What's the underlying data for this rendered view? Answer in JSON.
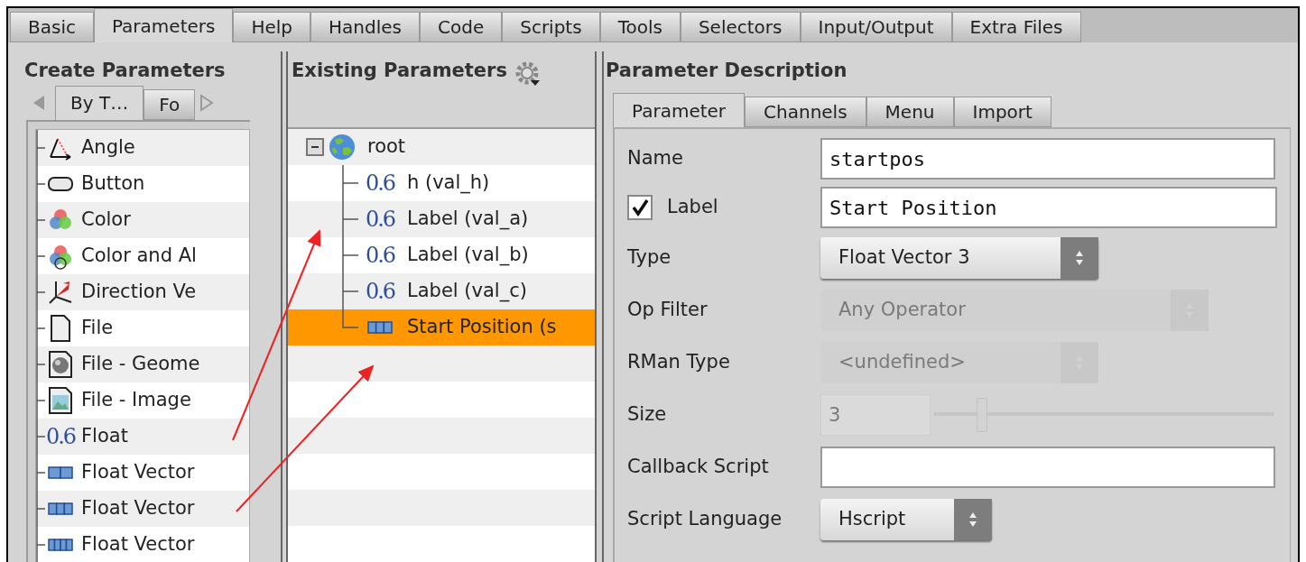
{
  "tabs": [
    {
      "label": "Basic",
      "selected": false
    },
    {
      "label": "Parameters",
      "selected": true
    },
    {
      "label": "Help",
      "selected": false
    },
    {
      "label": "Handles",
      "selected": false
    },
    {
      "label": "Code",
      "selected": false
    },
    {
      "label": "Scripts",
      "selected": false
    },
    {
      "label": "Tools",
      "selected": false
    },
    {
      "label": "Selectors",
      "selected": false
    },
    {
      "label": "Input/Output",
      "selected": false
    },
    {
      "label": "Extra Files",
      "selected": false
    }
  ],
  "create_parameters": {
    "title": "Create Parameters",
    "tabs": [
      {
        "label": "By T…",
        "selected": true
      },
      {
        "label": "Fo",
        "selected": false
      }
    ],
    "items": [
      {
        "label": "Angle",
        "kind": "angle"
      },
      {
        "label": "Button",
        "kind": "button"
      },
      {
        "label": "Color",
        "kind": "color"
      },
      {
        "label": "Color and Al",
        "kind": "color_alpha"
      },
      {
        "label": "Direction Ve",
        "kind": "direction"
      },
      {
        "label": "File",
        "kind": "file"
      },
      {
        "label": "File - Geome",
        "kind": "file_geometry"
      },
      {
        "label": "File - Image",
        "kind": "file_image"
      },
      {
        "label": "Float",
        "kind": "float",
        "icon_text": "0.6"
      },
      {
        "label": "Float Vector",
        "kind": "vector2"
      },
      {
        "label": "Float Vector",
        "kind": "vector3"
      },
      {
        "label": "Float Vector",
        "kind": "vector4"
      }
    ]
  },
  "existing_parameters": {
    "title": "Existing Parameters",
    "tree": {
      "label": "root",
      "expanded": true,
      "children": [
        {
          "label": "h (val_h)",
          "kind": "float",
          "icon_text": "0.6",
          "selected": false
        },
        {
          "label": "Label (val_a)",
          "kind": "float",
          "icon_text": "0.6",
          "selected": false
        },
        {
          "label": "Label (val_b)",
          "kind": "float",
          "icon_text": "0.6",
          "selected": false
        },
        {
          "label": "Label (val_c)",
          "kind": "float",
          "icon_text": "0.6",
          "selected": false
        },
        {
          "label": "Start Position (s",
          "kind": "vector3",
          "selected": true
        }
      ]
    }
  },
  "parameter_description": {
    "title": "Parameter Description",
    "tabs": [
      {
        "label": "Parameter",
        "selected": true
      },
      {
        "label": "Channels",
        "selected": false
      },
      {
        "label": "Menu",
        "selected": false
      },
      {
        "label": "Import",
        "selected": false
      }
    ],
    "fields": [
      {
        "kind": "text",
        "label": "Name",
        "value": "startpos"
      },
      {
        "kind": "checked_text",
        "label": "Label",
        "checked": true,
        "value": "Start Position"
      },
      {
        "kind": "select",
        "label": "Type",
        "value": "Float Vector 3",
        "disabled": false
      },
      {
        "kind": "select",
        "label": "Op Filter",
        "value": "Any Operator",
        "disabled": true
      },
      {
        "kind": "select",
        "label": "RMan Type",
        "value": "<undefined>",
        "disabled": true
      },
      {
        "kind": "slider",
        "label": "Size",
        "value": "3",
        "level": 0.14,
        "disabled": true
      },
      {
        "kind": "text",
        "label": "Callback Script"
      },
      {
        "kind": "select",
        "label": "Script Language",
        "value": "Hscript",
        "disabled": false
      }
    ]
  }
}
